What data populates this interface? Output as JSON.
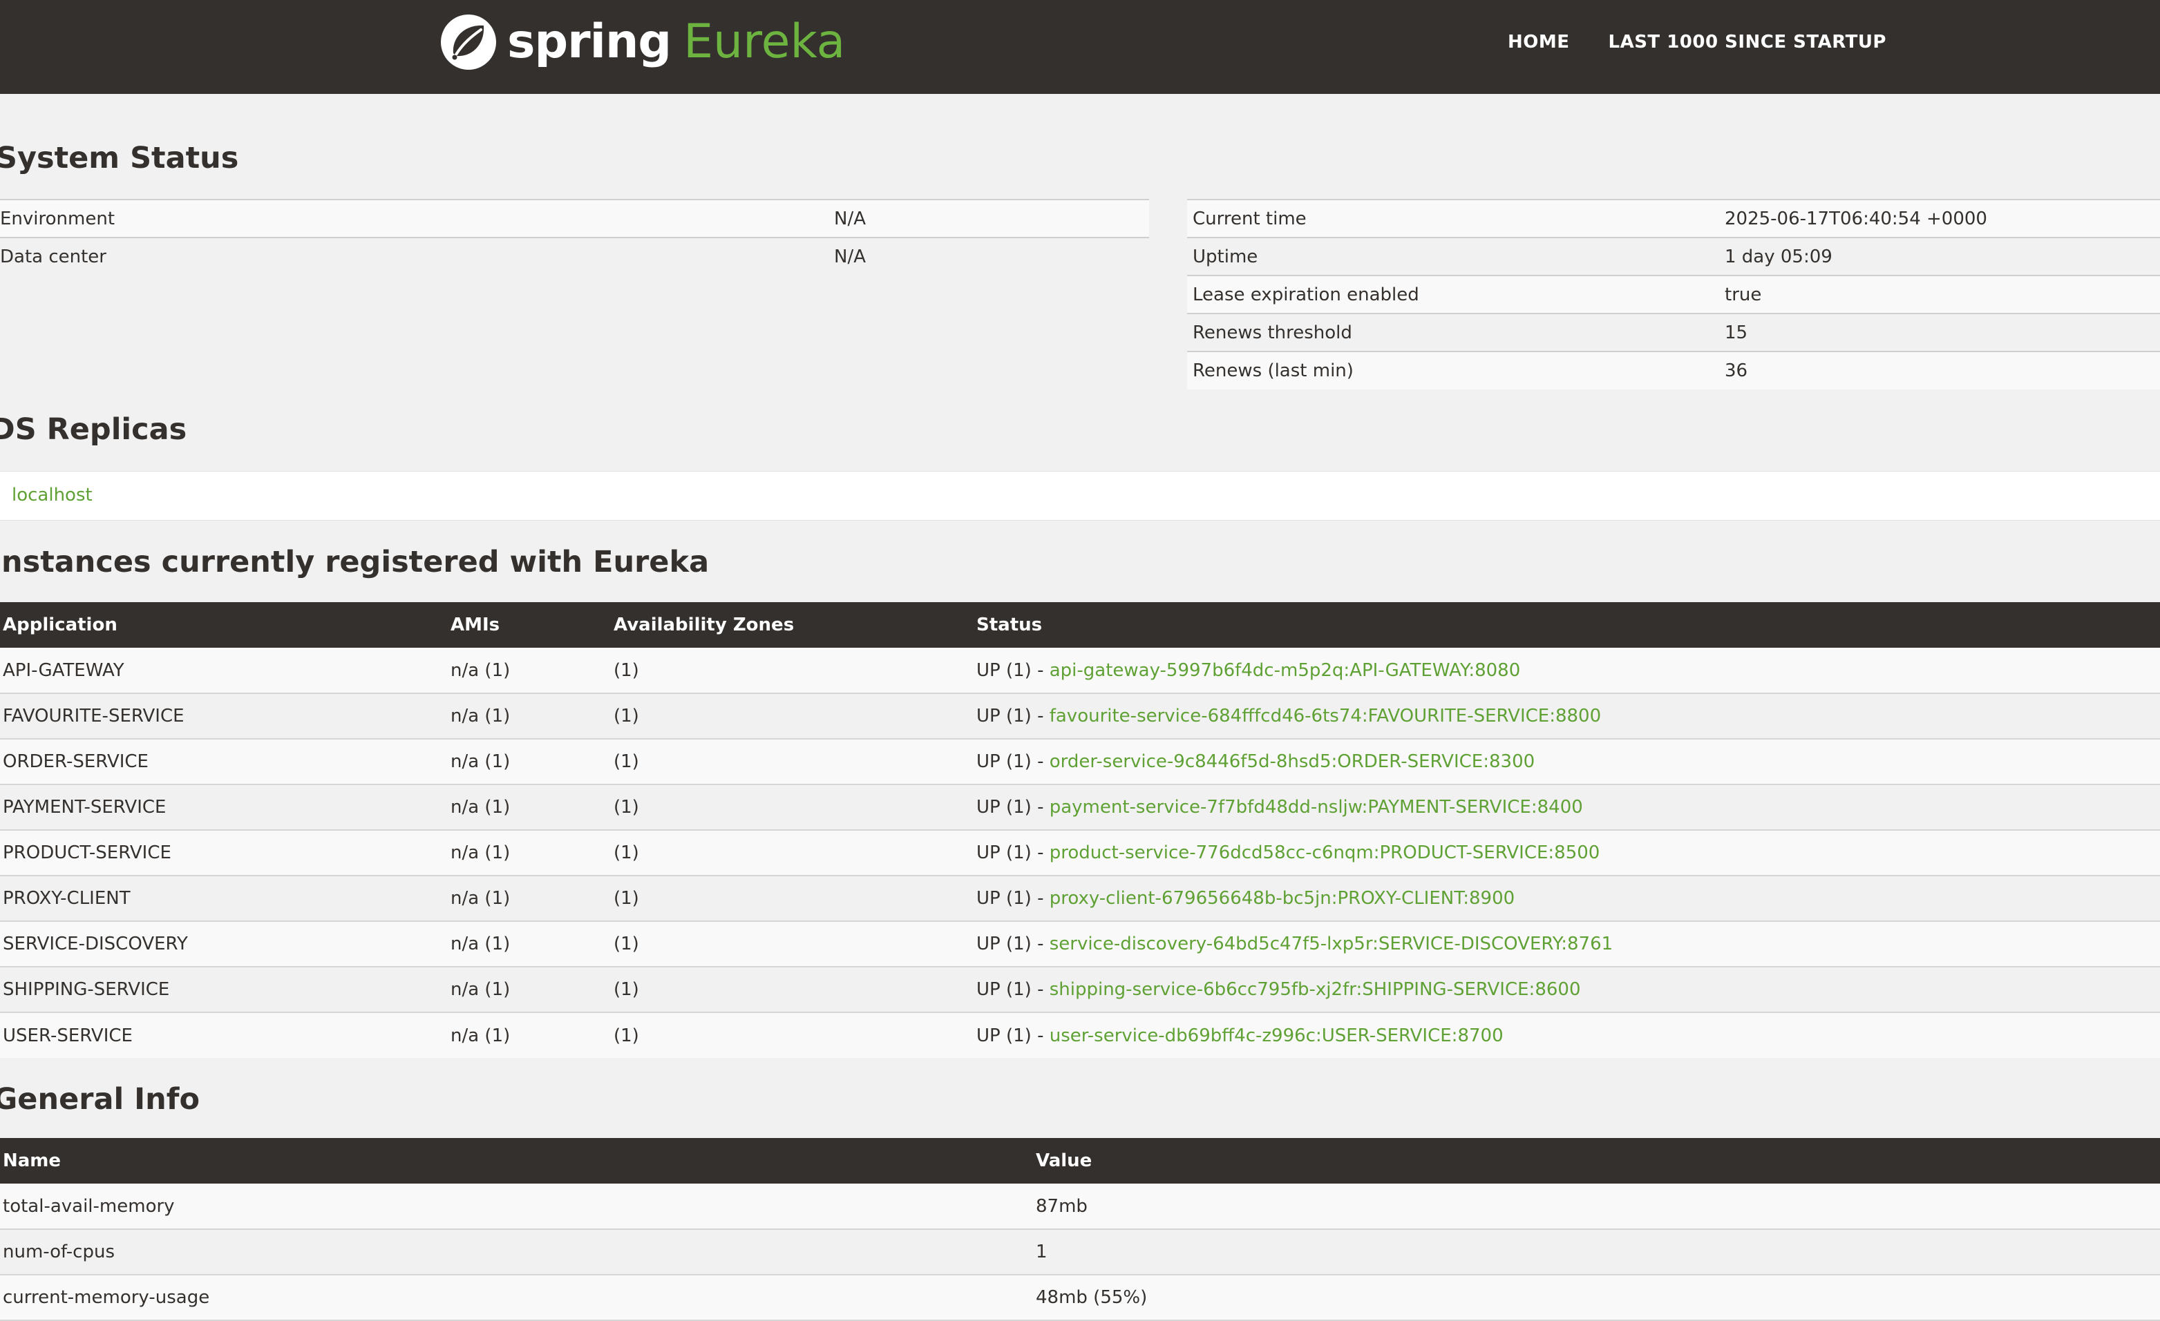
{
  "header": {
    "brand_spring": "spring",
    "brand_eureka": "Eureka",
    "nav": [
      "HOME",
      "LAST 1000 SINCE STARTUP"
    ]
  },
  "system_status": {
    "title": "System Status",
    "left": [
      {
        "label": "Environment",
        "value": "N/A"
      },
      {
        "label": "Data center",
        "value": "N/A"
      }
    ],
    "right": [
      {
        "label": "Current time",
        "value": "2025-06-17T06:40:54 +0000"
      },
      {
        "label": "Uptime",
        "value": "1 day 05:09"
      },
      {
        "label": "Lease expiration enabled",
        "value": "true"
      },
      {
        "label": "Renews threshold",
        "value": "15"
      },
      {
        "label": "Renews (last min)",
        "value": "36"
      }
    ]
  },
  "replicas": {
    "title": "DS Replicas",
    "items": [
      "localhost"
    ]
  },
  "instances": {
    "title": "Instances currently registered with Eureka",
    "columns": [
      "Application",
      "AMIs",
      "Availability Zones",
      "Status"
    ],
    "rows": [
      {
        "app": "API-GATEWAY",
        "amis": "n/a (1)",
        "zones": "(1)",
        "status": "UP (1) - ",
        "link": "api-gateway-5997b6f4dc-m5p2q:API-GATEWAY:8080"
      },
      {
        "app": "FAVOURITE-SERVICE",
        "amis": "n/a (1)",
        "zones": "(1)",
        "status": "UP (1) - ",
        "link": "favourite-service-684fffcd46-6ts74:FAVOURITE-SERVICE:8800"
      },
      {
        "app": "ORDER-SERVICE",
        "amis": "n/a (1)",
        "zones": "(1)",
        "status": "UP (1) - ",
        "link": "order-service-9c8446f5d-8hsd5:ORDER-SERVICE:8300"
      },
      {
        "app": "PAYMENT-SERVICE",
        "amis": "n/a (1)",
        "zones": "(1)",
        "status": "UP (1) - ",
        "link": "payment-service-7f7bfd48dd-nsljw:PAYMENT-SERVICE:8400"
      },
      {
        "app": "PRODUCT-SERVICE",
        "amis": "n/a (1)",
        "zones": "(1)",
        "status": "UP (1) - ",
        "link": "product-service-776dcd58cc-c6nqm:PRODUCT-SERVICE:8500"
      },
      {
        "app": "PROXY-CLIENT",
        "amis": "n/a (1)",
        "zones": "(1)",
        "status": "UP (1) - ",
        "link": "proxy-client-679656648b-bc5jn:PROXY-CLIENT:8900"
      },
      {
        "app": "SERVICE-DISCOVERY",
        "amis": "n/a (1)",
        "zones": "(1)",
        "status": "UP (1) - ",
        "link": "service-discovery-64bd5c47f5-lxp5r:SERVICE-DISCOVERY:8761"
      },
      {
        "app": "SHIPPING-SERVICE",
        "amis": "n/a (1)",
        "zones": "(1)",
        "status": "UP (1) - ",
        "link": "shipping-service-6b6cc795fb-xj2fr:SHIPPING-SERVICE:8600"
      },
      {
        "app": "USER-SERVICE",
        "amis": "n/a (1)",
        "zones": "(1)",
        "status": "UP (1) - ",
        "link": "user-service-db69bff4c-z996c:USER-SERVICE:8700"
      }
    ]
  },
  "general_info": {
    "title": "General Info",
    "columns": [
      "Name",
      "Value"
    ],
    "rows": [
      {
        "name": "total-avail-memory",
        "value": "87mb"
      },
      {
        "name": "num-of-cpus",
        "value": "1"
      },
      {
        "name": "current-memory-usage",
        "value": "48mb (55%)"
      }
    ]
  },
  "colors": {
    "navbar": "#34302d",
    "accent_green": "#6db33f",
    "link_green": "#5fa134",
    "page_bg": "#f1f1f1"
  }
}
